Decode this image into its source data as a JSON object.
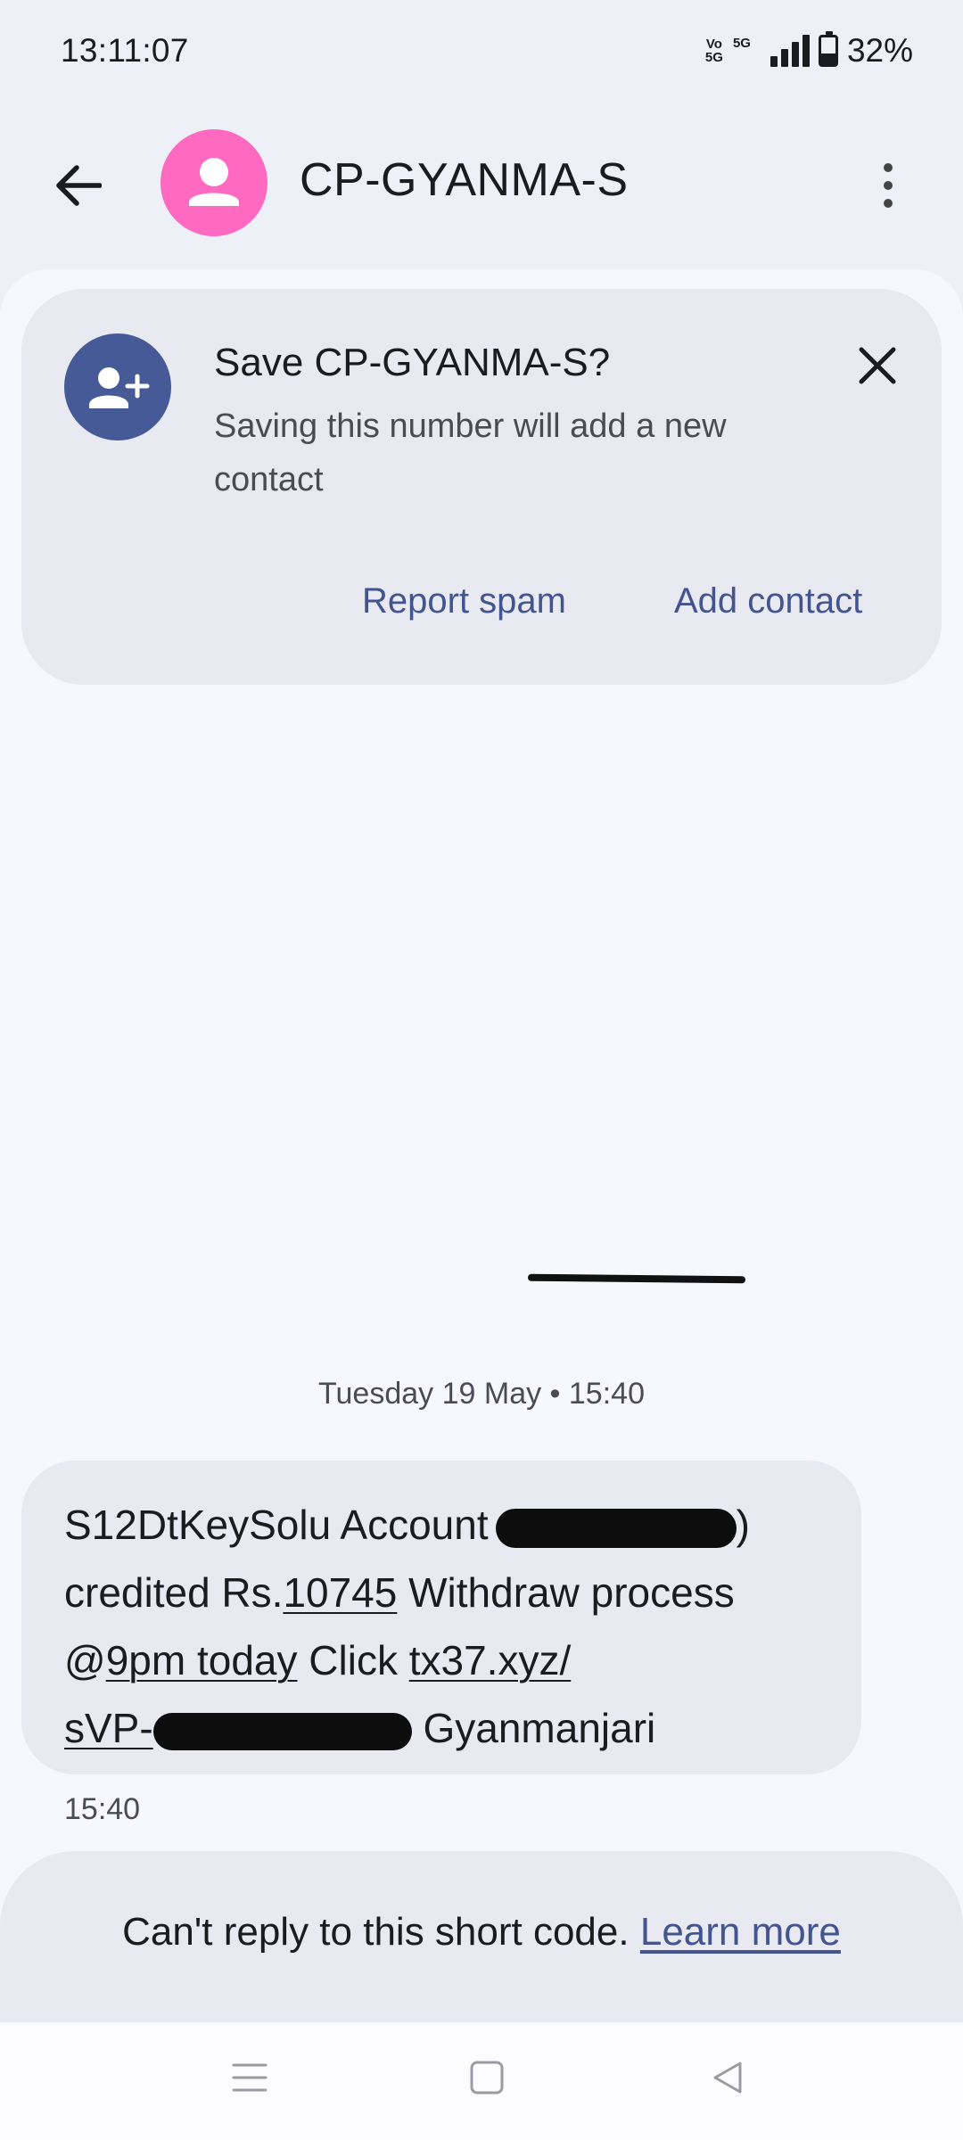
{
  "status_bar": {
    "time": "13:11:07",
    "volte": "Vo 5G",
    "network": "5G",
    "battery_text": "32%",
    "battery_level": 0.32
  },
  "app_bar": {
    "title": "CP-GYANMA-S",
    "avatar_color": "#ff69c0"
  },
  "save_prompt": {
    "title": "Save CP-GYANMA-S?",
    "description": "Saving this number will add a new contact",
    "report_spam_label": "Report spam",
    "add_contact_label": "Add contact"
  },
  "conversation": {
    "date_separator": "Tuesday 19 May • 15:40",
    "message": {
      "part1": "S12DtKeySolu Account",
      "part1_close": ")",
      "part2_prefix": "credited Rs.",
      "amount": "10745",
      "part2_suffix": " Withdraw process",
      "at_sign": "@",
      "time_link": "9pm today",
      "click": " Click ",
      "link_line1": "tx37.xyz/",
      "link_line2": "sVP-",
      "sender_suffix": "Gyanmanjari"
    },
    "message_time": "15:40"
  },
  "footer": {
    "no_reply_text": "Can't reply to this short code.",
    "learn_more_label": "Learn more"
  },
  "colors": {
    "background": "#eef0f8",
    "accent": "#43558e",
    "card": "#e8e9f1"
  }
}
